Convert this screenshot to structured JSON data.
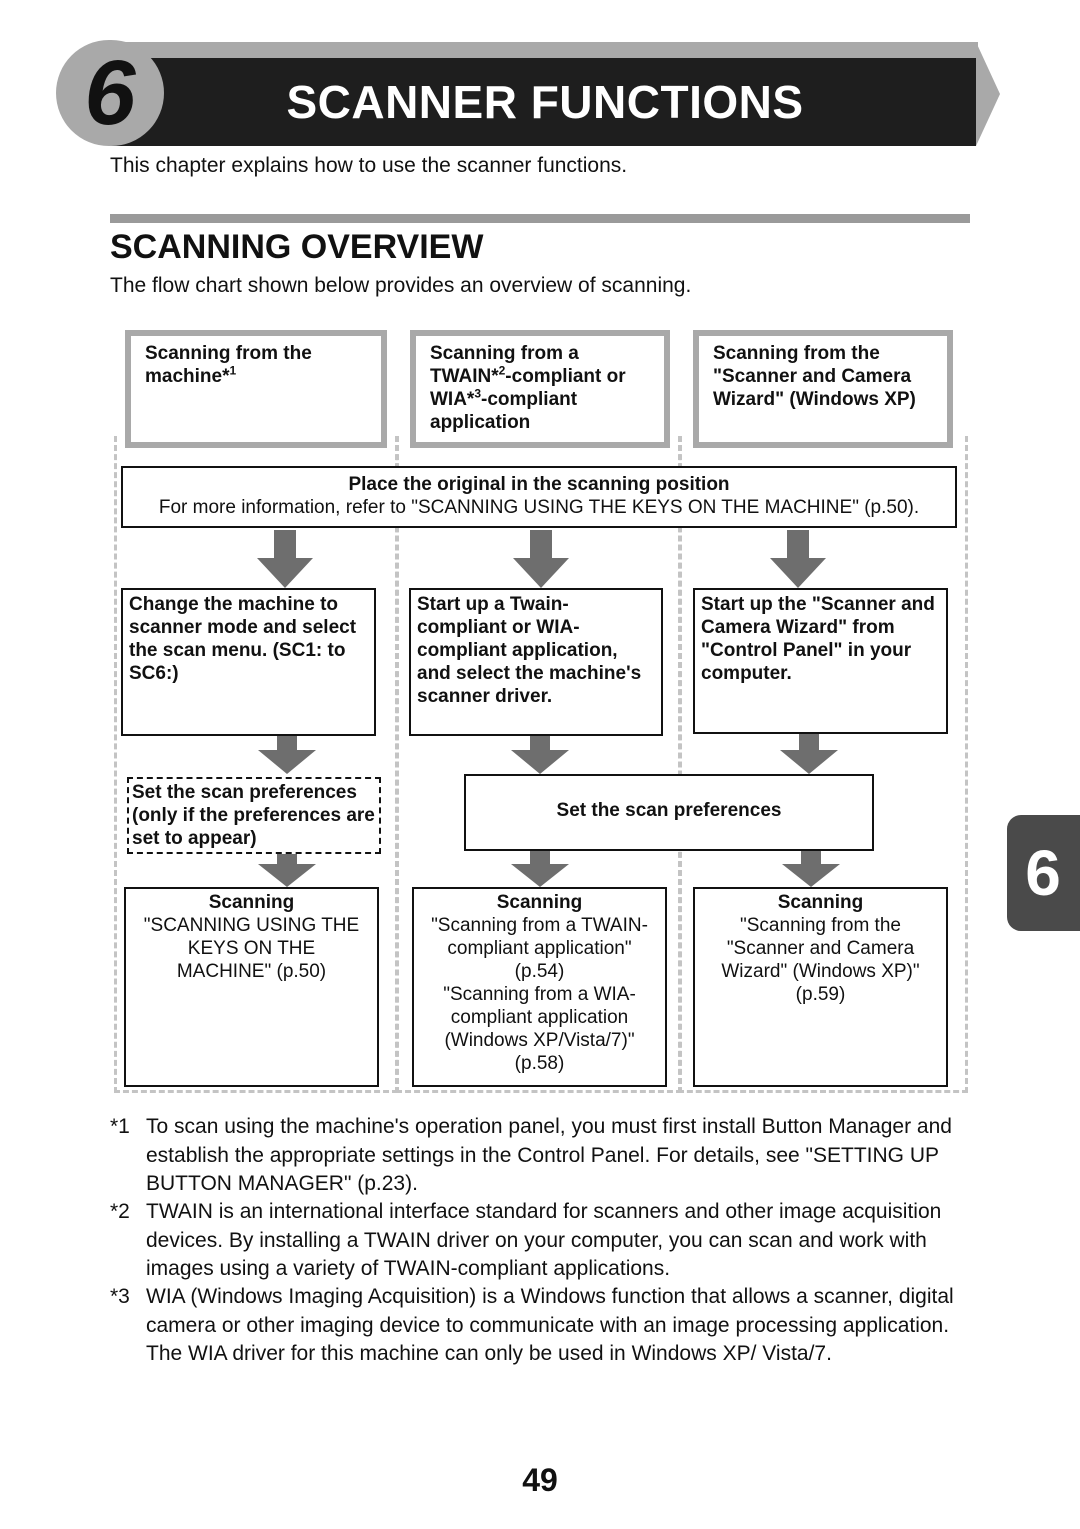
{
  "chapter": {
    "number": "6",
    "title": "SCANNER FUNCTIONS",
    "intro": "This chapter explains how to use the scanner functions."
  },
  "section": {
    "title": "SCANNING OVERVIEW",
    "intro": "The flow chart shown below provides an overview of scanning."
  },
  "flowchart": {
    "columns": [
      {
        "header": "Scanning from the machine*",
        "header_sup": "1"
      },
      {
        "header_parts": [
          "Scanning from a TWAIN*",
          "2",
          "-compliant or WIA*",
          "3",
          "-compliant application"
        ]
      },
      {
        "header": "Scanning from the \"Scanner and Camera Wizard\" (Windows XP)"
      }
    ],
    "place_original": {
      "title": "Place the original in the scanning position",
      "detail": "For more information, refer to \"SCANNING USING THE KEYS ON THE MACHINE\" (p.50)."
    },
    "step2": [
      "Change the machine to scanner mode and select the scan menu. (SC1: to SC6:)",
      "Start up a Twain-compliant or WIA-compliant application, and select the machine's scanner driver.",
      "Start up the \"Scanner and Camera Wizard\" from \"Control Panel\" in your computer."
    ],
    "step3_optional": "Set the scan preferences (only if the preferences are set to appear)",
    "step3_shared": "Set the scan preferences",
    "scanning": [
      {
        "title": "Scanning",
        "lines": [
          "\"SCANNING USING THE",
          "KEYS ON THE",
          "MACHINE\" (p.50)"
        ]
      },
      {
        "title": "Scanning",
        "lines": [
          "\"Scanning from a TWAIN-",
          "compliant application\"",
          "(p.54)",
          "\"Scanning from a WIA-",
          "compliant application",
          "(Windows XP/Vista/7)\"",
          "(p.58)"
        ]
      },
      {
        "title": "Scanning",
        "lines": [
          "\"Scanning from the",
          "\"Scanner and Camera",
          "Wizard\" (Windows XP)\"",
          "(p.59)"
        ]
      }
    ]
  },
  "footnotes": [
    {
      "mark": "*1",
      "text": "To scan using the machine's operation panel, you must first install Button Manager and establish the appropriate settings in the Control Panel. For details, see \"SETTING UP BUTTON MANAGER\" (p.23)."
    },
    {
      "mark": "*2",
      "text": "TWAIN is an international interface standard for scanners and other image acquisition devices. By installing a TWAIN driver on your computer, you can scan and work with images using a variety of TWAIN-compliant applications."
    },
    {
      "mark": "*3",
      "text": "WIA (Windows Imaging Acquisition) is a Windows function that allows a scanner, digital camera or other imaging device to communicate with an image processing application. The WIA driver for this machine can only be used in Windows XP/ Vista/7."
    }
  ],
  "page_number": "49",
  "side_tab": "6",
  "colors": {
    "header_bar": "#1e1e1e",
    "header_accent": "#a9a9a9",
    "arrow": "#6e6e6e",
    "side_tab": "#4a4a4a"
  }
}
